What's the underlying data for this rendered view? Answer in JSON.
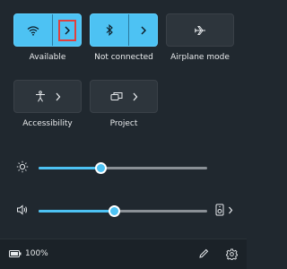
{
  "quick_settings": {
    "tiles": [
      {
        "label": "Available",
        "icon": "wifi-icon",
        "state": "on",
        "has_chevron": true
      },
      {
        "label": "Not connected",
        "icon": "bluetooth-icon",
        "state": "on",
        "has_chevron": true
      },
      {
        "label": "Airplane mode",
        "icon": "airplane-icon",
        "state": "off",
        "has_chevron": false
      },
      {
        "label": "Accessibility",
        "icon": "accessibility-icon",
        "state": "off",
        "has_chevron": true
      },
      {
        "label": "Project",
        "icon": "project-icon",
        "state": "off",
        "has_chevron": true
      }
    ],
    "brightness": {
      "icon": "brightness-icon",
      "level_percent": 37
    },
    "volume": {
      "icon": "speaker-icon",
      "level_percent": 45,
      "output_icon": "audio-device-icon"
    }
  },
  "footer": {
    "battery_icon": "battery-icon",
    "battery_text": "100%",
    "edit_icon": "pencil-icon",
    "settings_icon": "gear-icon"
  },
  "colors": {
    "background": "#20282f",
    "accent": "#4dc2f3",
    "tile_off": "#2d353c",
    "highlight": "#e0413f"
  }
}
